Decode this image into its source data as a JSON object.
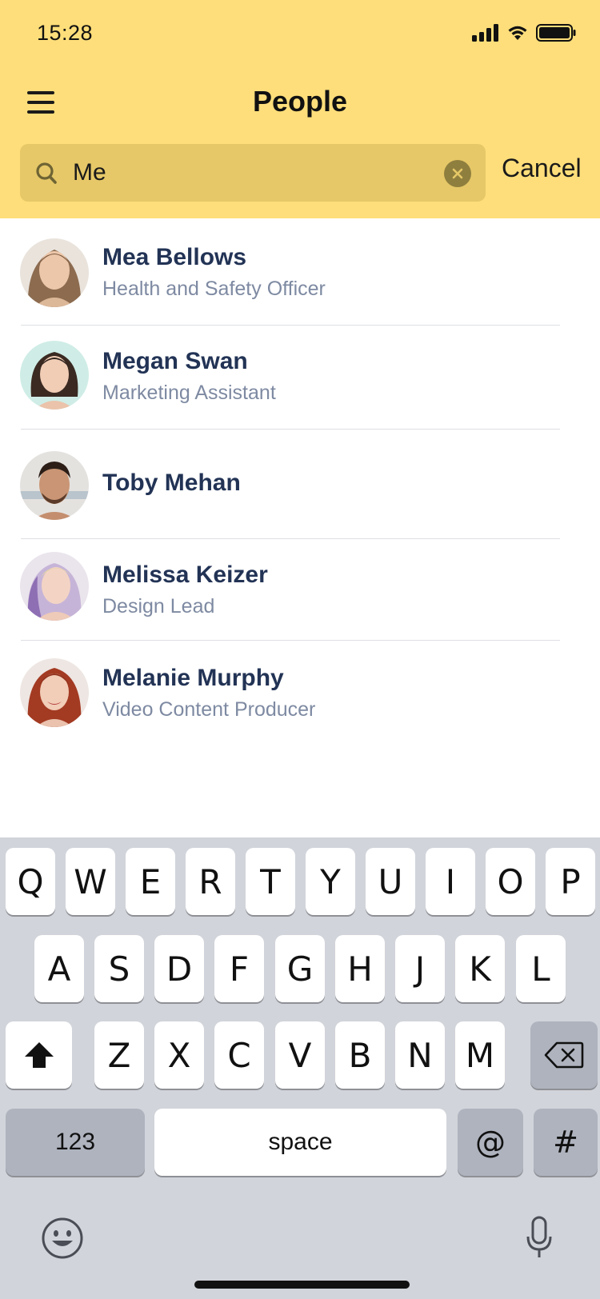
{
  "status_bar": {
    "time": "15:28"
  },
  "header": {
    "title": "People",
    "cancel_label": "Cancel"
  },
  "search": {
    "value": "Me"
  },
  "people": [
    {
      "name": "Mea Bellows",
      "role": "Health and Safety Officer"
    },
    {
      "name": "Megan Swan",
      "role": "Marketing  Assistant"
    },
    {
      "name": "Toby Mehan",
      "role": ""
    },
    {
      "name": "Melissa Keizer",
      "role": "Design Lead"
    },
    {
      "name": "Melanie Murphy",
      "role": "Video Content Producer"
    }
  ],
  "keyboard": {
    "row1": [
      "Q",
      "W",
      "E",
      "R",
      "T",
      "Y",
      "U",
      "I",
      "O",
      "P"
    ],
    "row2": [
      "A",
      "S",
      "D",
      "F",
      "G",
      "H",
      "J",
      "K",
      "L"
    ],
    "row3": [
      "Z",
      "X",
      "C",
      "V",
      "B",
      "N",
      "M"
    ],
    "numbers_label": "123",
    "space_label": "space",
    "at_label": "@",
    "hash_label": "#"
  },
  "colors": {
    "header_bg": "#FEDE7A",
    "search_bg": "#E6C868",
    "name": "#223355",
    "role": "#7E8AA2"
  }
}
